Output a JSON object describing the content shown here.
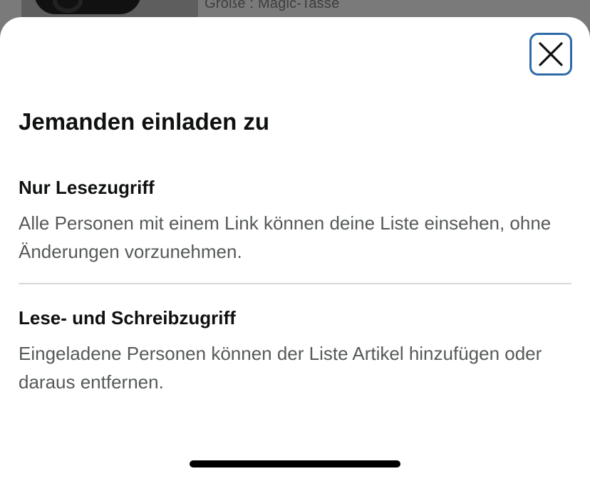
{
  "background": {
    "size_text": "Größe : Magic-Tasse"
  },
  "sheet": {
    "title": "Jemanden einladen zu",
    "close_icon": "close-icon",
    "options": [
      {
        "title": "Nur Lesezugriff",
        "description": "Alle Personen mit einem Link können deine Liste einsehen, ohne Änderungen vorzunehmen."
      },
      {
        "title": "Lese- und Schreibzugriff",
        "description": "Eingeladene Personen können der Liste Artikel hinzufügen oder daraus entfernen."
      }
    ]
  },
  "colors": {
    "focus_ring": "#2d6aa6",
    "text_primary": "#0f1111",
    "text_secondary": "#565959",
    "divider": "#d5d9d9"
  }
}
